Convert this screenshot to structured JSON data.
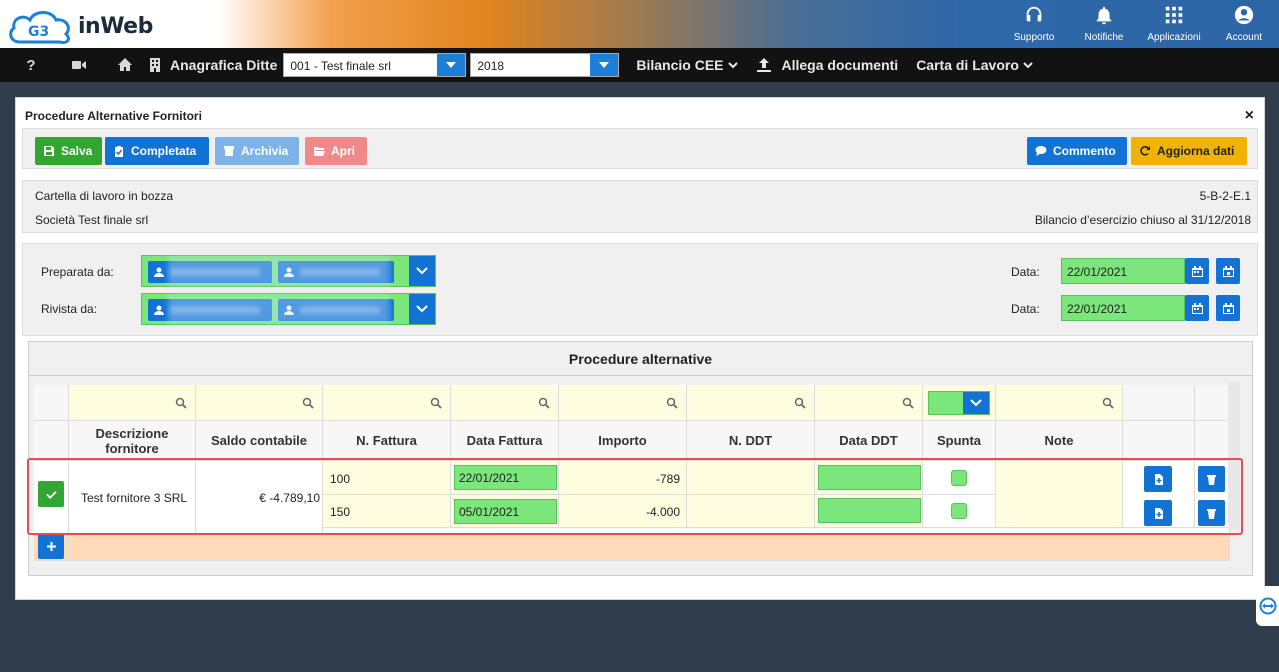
{
  "brand": {
    "logo_letters": "G3",
    "name": "inWeb"
  },
  "top_icons": [
    {
      "label": "Supporto",
      "icon": "headset-icon"
    },
    {
      "label": "Notifiche",
      "icon": "bell-icon"
    },
    {
      "label": "Applicazioni",
      "icon": "grid-icon"
    },
    {
      "label": "Account",
      "icon": "user-circle-icon"
    }
  ],
  "navbar": {
    "anagrafica_label": "Anagrafica Ditte",
    "company_select": "001 - Test finale srl",
    "year_select": "2018",
    "bilancio_menu": "Bilancio CEE",
    "allega_label": "Allega documenti",
    "carta_menu": "Carta di Lavoro"
  },
  "panel": {
    "title": "Procedure Alternative Fornitori",
    "close": "×"
  },
  "toolbar": {
    "salva": "Salva",
    "completata": "Completata",
    "archivia": "Archivia",
    "apri": "Apri",
    "commento": "Commento",
    "aggiorna": "Aggiorna dati"
  },
  "info": {
    "status": "Cartella di lavoro in bozza",
    "company": "Società Test finale srl",
    "code": "5-B-2-E.1",
    "balance": "Bilancio d’esercizio chiuso al 31/12/2018"
  },
  "signatures": {
    "preparata_label": "Preparata da:",
    "rivista_label": "Rivista da:",
    "data_label": "Data:",
    "preparata_date": "22/01/2021",
    "rivista_date": "22/01/2021"
  },
  "procedure": {
    "title": "Procedure alternative",
    "columns": [
      "Descrizione fornitore",
      "Saldo contabile",
      "N. Fattura",
      "Data Fattura",
      "Importo",
      "N. DDT",
      "Data DDT",
      "Spunta",
      "Note"
    ],
    "row": {
      "fornitore": "Test fornitore 3 SRL",
      "saldo": "€ -4.789,10",
      "items": [
        {
          "n_fattura": "100",
          "data_fattura": "22/01/2021",
          "importo": "-789",
          "n_ddt": "",
          "data_ddt": ""
        },
        {
          "n_fattura": "150",
          "data_fattura": "05/01/2021",
          "importo": "-4.000",
          "n_ddt": "",
          "data_ddt": ""
        }
      ]
    }
  },
  "colors": {
    "accent_blue": "#1273d4",
    "success_green": "#33a532",
    "input_green": "#7be67b",
    "highlight_red": "#e05050",
    "warning_orange": "#f0b400"
  }
}
